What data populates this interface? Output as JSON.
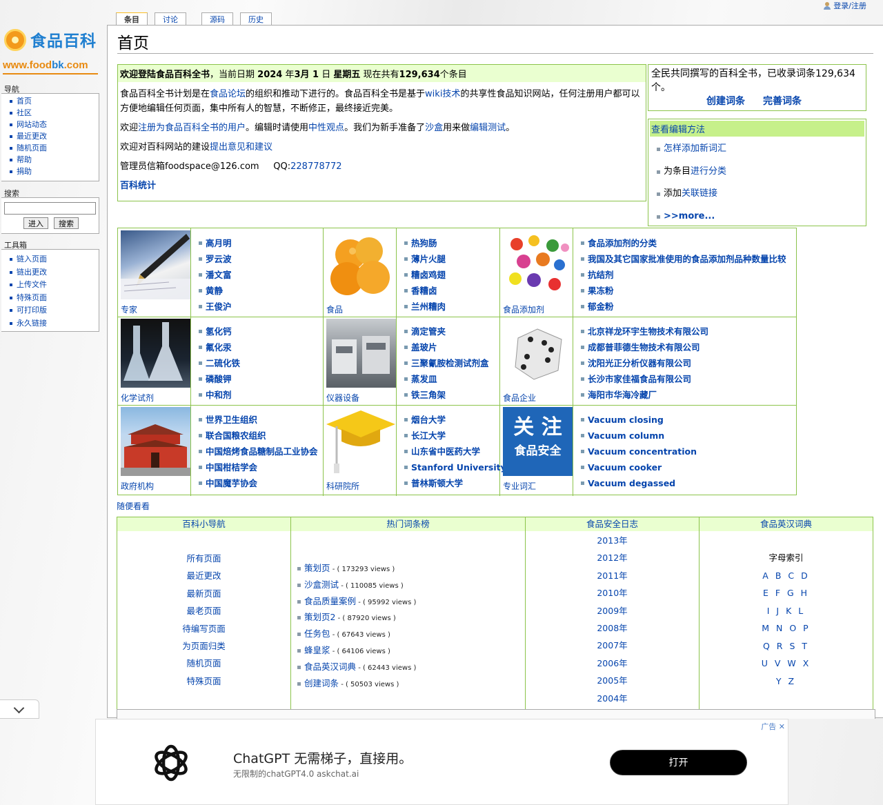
{
  "personal": {
    "login": "登录/注册"
  },
  "logo": {
    "name": "食品百科",
    "url_a": "www.food",
    "url_b": "bk",
    "url_c": ".com"
  },
  "sidebar": {
    "nav_title": "导航",
    "nav": [
      "首页",
      "社区",
      "网站动态",
      "最近更改",
      "随机页面",
      "帮助",
      "捐助"
    ],
    "search_title": "搜索",
    "search_go": "进入",
    "search_btn": "搜索",
    "tools_title": "工具箱",
    "tools": [
      "链入页面",
      "链出更改",
      "上传文件",
      "特殊页面",
      "可打印版",
      "永久链接"
    ]
  },
  "tabs": [
    "条目",
    "讨论",
    "源码",
    "历史"
  ],
  "page_title": "首页",
  "welcome": {
    "h_a": "欢迎登陆食品百科全书",
    "h_b": "，当前日期 ",
    "h_year": "2024",
    "h_c": " 年",
    "h_month": "3月 1",
    "h_d": " 日 ",
    "h_weekday": "星期五",
    "h_e": " 现在共有",
    "h_count": "129,634",
    "h_f": "个条目",
    "p1_a": "食品百科全书计划是在",
    "p1_link1": "食品论坛",
    "p1_b": "的组织和推动下进行的。食品百科全书是基于",
    "p1_link2": "wiki技术",
    "p1_c": "的共享性食品知识网站，任何注册用户都可以方便地编辑任何页面，集中所有人的智慧，不断修正，最终接近完美。",
    "p2_a": "欢迎",
    "p2_link1": "注册为食品百科全书的用户",
    "p2_b": "。编辑时请使用",
    "p2_link2": "中性观点",
    "p2_c": "。我们为新手准备了",
    "p2_link3": "沙盒",
    "p2_d": "用来做",
    "p2_link4": "编辑测试",
    "p2_e": "。",
    "p3_a": "欢迎对百科网站的建设",
    "p3_link": "提出意见和建议",
    "p4_a": "管理员信箱foodspace@126.com",
    "p4_qq": "QQ:",
    "p4_qqnum": "228778772",
    "stats": "百科统计"
  },
  "rbox1": {
    "text": "全民共同撰写的百科全书，已收录词条129,634个。",
    "create": "创建词条",
    "improve": "完善词条"
  },
  "rbox2": {
    "title": "查看编辑方法",
    "i1": "怎样添加新词汇",
    "i2a": "为条目",
    "i2b": "进行分类",
    "i3a": "添加",
    "i3b": "关联链接",
    "i4": ">>more..."
  },
  "grid": [
    {
      "cap": "专家",
      "items": [
        "高月明",
        "罗云波",
        "潘文富",
        "黄静",
        "王俊沪"
      ]
    },
    {
      "cap": "食品",
      "items": [
        "热狗肠",
        "薄片火腿",
        "糟卤鸡翅",
        "香糟卤",
        "兰州糟肉"
      ]
    },
    {
      "cap": "食品添加剂",
      "items": [
        "食品添加剂的分类",
        "我国及其它国家批准使用的食品添加剂品种数量比较",
        "抗结剂",
        "果冻粉",
        "郁金粉"
      ]
    },
    {
      "cap": "化学试剂",
      "items": [
        "氢化钙",
        "氟化汞",
        "二硫化铁",
        "磷酸钾",
        "中和剂"
      ]
    },
    {
      "cap": "仪器设备",
      "items": [
        "滴定管夹",
        "盖玻片",
        "三聚氰胺检测试剂盒",
        "蒸发皿",
        "铁三角架"
      ]
    },
    {
      "cap": "食品企业",
      "items": [
        "北京祥龙环宇生物技术有限公司",
        "成都普菲德生物技术有限公司",
        "沈阳光正分析仪器有限公司",
        "长沙市家佳福食品有限公司",
        "海阳市华海冷藏厂"
      ]
    },
    {
      "cap": "政府机构",
      "items": [
        "世界卫生组织",
        "联合国粮农组织",
        "中国焙烤食品糖制品工业协会",
        "中国柑桔学会",
        "中国魔芋协会"
      ]
    },
    {
      "cap": "科研院所",
      "items": [
        "烟台大学",
        "长江大学",
        "山东省中医药大学",
        "Stanford University",
        "普林斯顿大学"
      ]
    },
    {
      "cap": "专业词汇",
      "items": [
        "Vacuum closing",
        "Vacuum column",
        "Vacuum concentration",
        "Vacuum cooker",
        "Vacuum degassed"
      ]
    }
  ],
  "badge": {
    "l1": "关 注",
    "l2": "食品安全"
  },
  "random": "随便看看",
  "bottom": {
    "nav_title": "百科小导航",
    "nav": [
      "所有页面",
      "最近更改",
      "最新页面",
      "最老页面",
      "待编写页面",
      "为页面归类",
      "随机页面",
      "特殊页面"
    ],
    "hot_title": "热门词条榜",
    "hot": [
      {
        "t": "策划页",
        "v": " - ( 173293 views )"
      },
      {
        "t": "沙盒测试",
        "v": " - ( 110085 views )"
      },
      {
        "t": "食品质量案例",
        "v": " - ( 95992 views )"
      },
      {
        "t": "策划页2",
        "v": " - ( 87920 views )"
      },
      {
        "t": "任务包",
        "v": " - ( 67643 views )"
      },
      {
        "t": "蜂皇浆",
        "v": " - ( 64106 views )"
      },
      {
        "t": "食品英汉词典",
        "v": " - ( 62443 views )"
      },
      {
        "t": "创建词条",
        "v": " - ( 50503 views )"
      }
    ],
    "log_title": "食品安全日志",
    "years": [
      "2013年",
      "2012年",
      "2011年",
      "2010年",
      "2009年",
      "2008年",
      "2007年",
      "2006年",
      "2005年",
      "2004年"
    ],
    "dict_title": "食品英汉词典",
    "dict_head": "字母索引",
    "letters": [
      "A B C D",
      "E F G H",
      "I J K L",
      "M N O P",
      "Q R S T",
      "U V W X",
      "Y Z"
    ]
  },
  "ad": {
    "tag": "广告",
    "title": "ChatGPT 无需梯子，直接用。",
    "sub": "无限制的chatGPT4.0 askchat.ai",
    "open": "打开"
  }
}
